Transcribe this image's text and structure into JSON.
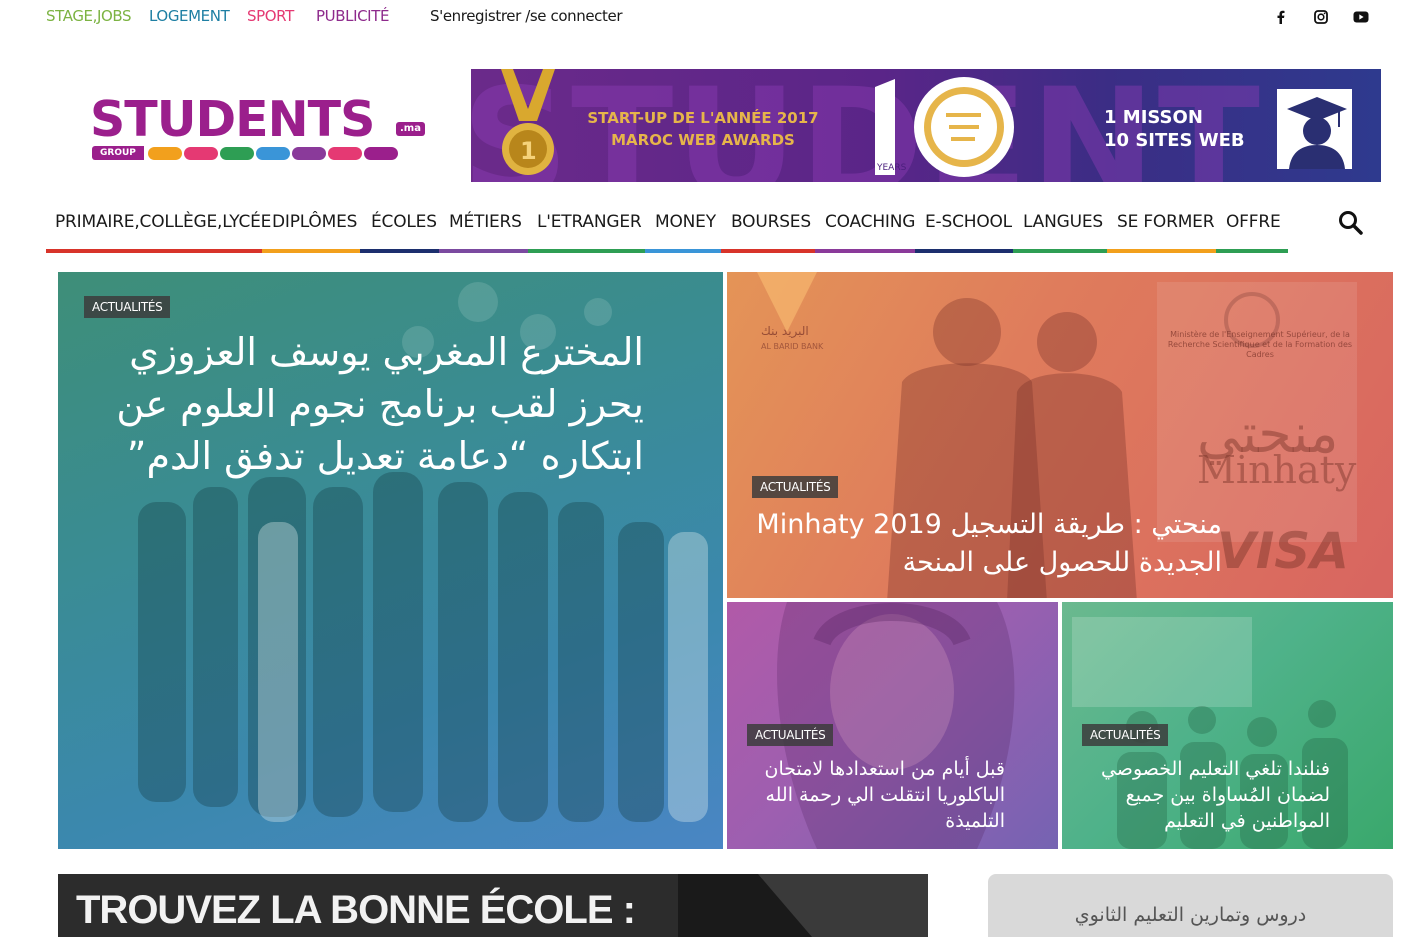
{
  "top_links": [
    {
      "label": "STAGE,JOBS",
      "color": "#7cb342"
    },
    {
      "label": "LOGEMENT",
      "color": "#1e7fa3"
    },
    {
      "label": "SPORT",
      "color": "#e53973"
    },
    {
      "label": "PUBLICITÉ",
      "color": "#8e2a8c"
    }
  ],
  "auth_link": "S'enregistrer /se connecter",
  "social_icons": [
    "facebook-icon",
    "instagram-icon",
    "youtube-icon"
  ],
  "logo": {
    "word": "STUDENTS",
    "suffix": ".ma",
    "group": "GROUP"
  },
  "banner": {
    "award_line1": "START-UP DE L'ANNÉE 2017",
    "award_line2": "MAROC WEB AWARDS",
    "medal_number": "1",
    "years": "YEARS",
    "mission_line1": "1 MISSON",
    "mission_line2": "10 SITES WEB"
  },
  "nav": [
    {
      "label": "PRIMAIRE,COLLÈGE,LYCÉE",
      "color": "#d8342a"
    },
    {
      "label": "DIPLÔMES",
      "color": "#f2a01d"
    },
    {
      "label": "ÉCOLES",
      "color": "#1c2f6e"
    },
    {
      "label": "MÉTIERS",
      "color": "#7b4aa0"
    },
    {
      "label": "L'ETRANGER",
      "color": "#2e9e54"
    },
    {
      "label": "MONEY",
      "color": "#3a95d8"
    },
    {
      "label": "BOURSES",
      "color": "#d8342a"
    },
    {
      "label": "COACHING",
      "color": "#8a3a9a"
    },
    {
      "label": "E-SCHOOL",
      "color": "#1c2f6e"
    },
    {
      "label": "LANGUES",
      "color": "#2e9e54"
    },
    {
      "label": "SE FORMER",
      "color": "#f2a01d"
    },
    {
      "label": "OFFRE",
      "color": "#2e9e54"
    }
  ],
  "search_icon": "search-icon",
  "featured": [
    {
      "badge": "ACTUALITÉS",
      "title": "المخترع المغربي يوسف العزوزي يحرز لقب برنامج نجوم العلوم عن ابتكاره “دعامة تعديل تدفق الدم”"
    },
    {
      "badge": "ACTUALITÉS",
      "title": "منحتي : طريقة التسجيل Minhaty 2019 الجديدة للحصول على المنحة",
      "image_text": "منحتي",
      "image_text_latin": "Minhaty",
      "image_brand": "VISA",
      "ministry": "Ministère de l'Enseignement Supérieur, de la Recherche Scientifique et de la Formation des Cadres",
      "bank": "AL BARID BANK",
      "bank_ar": "البريد بنك"
    },
    {
      "badge": "ACTUALITÉS",
      "title": "قبل أيام من استعدادها لامتحان الباكلوريا انتقلت الي رحمة الله التلميذة"
    },
    {
      "badge": "ACTUALITÉS",
      "title": "فنلندا تلغي التعليم الخصوصي لضمان المُساواة بين جميع المواطنين في التعليم"
    }
  ],
  "bottom_banner": "TROUVEZ LA BONNE ÉCOLE :",
  "widget_title": "دروس وتمارين التعليم الثانوي"
}
